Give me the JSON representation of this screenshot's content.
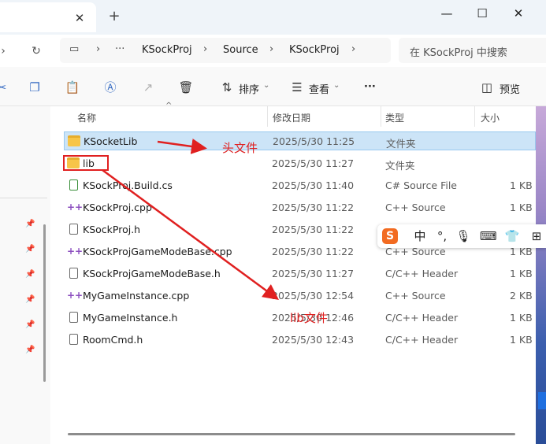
{
  "window": {
    "close_tab_glyph": "✕",
    "new_tab_glyph": "+",
    "minimize_glyph": "—",
    "maximize_glyph": "☐",
    "close_glyph": "✕"
  },
  "navbar": {
    "breadcrumbs": [
      "KSockProj",
      "Source",
      "KSockProj"
    ],
    "more_glyph": "···",
    "search_placeholder": "在 KSockProj 中搜索"
  },
  "commandbar": {
    "sort_label": "排序",
    "view_label": "查看",
    "more_glyph": "···",
    "preview_label": "预览"
  },
  "columns": {
    "name": "名称",
    "modified": "修改日期",
    "type": "类型",
    "size": "大小"
  },
  "files": [
    {
      "name": "KSocketLib",
      "date": "2025/5/30 11:25",
      "type": "文件夹",
      "size": "",
      "icon": "folder-icon",
      "selected": true
    },
    {
      "name": "lib",
      "date": "2025/5/30 11:27",
      "type": "文件夹",
      "size": "",
      "icon": "folder-icon",
      "selected": false
    },
    {
      "name": "KSockProj.Build.cs",
      "date": "2025/5/30 11:40",
      "type": "C# Source File",
      "size": "1 KB",
      "icon": "csharp-file-icon",
      "selected": false
    },
    {
      "name": "KSockProj.cpp",
      "date": "2025/5/30 11:22",
      "type": "C++ Source",
      "size": "1 KB",
      "icon": "cpp-file-icon",
      "selected": false
    },
    {
      "name": "KSockProj.h",
      "date": "2025/5/30 11:22",
      "type": "",
      "size": "",
      "icon": "header-file-icon",
      "selected": false
    },
    {
      "name": "KSockProjGameModeBase.cpp",
      "date": "2025/5/30 11:22",
      "type": "C++ Source",
      "size": "1 KB",
      "icon": "cpp-file-icon",
      "selected": false
    },
    {
      "name": "KSockProjGameModeBase.h",
      "date": "2025/5/30 11:27",
      "type": "C/C++ Header",
      "size": "1 KB",
      "icon": "header-file-icon",
      "selected": false
    },
    {
      "name": "MyGameInstance.cpp",
      "date": "2025/5/30 12:54",
      "type": "C++ Source",
      "size": "2 KB",
      "icon": "cpp-file-icon",
      "selected": false
    },
    {
      "name": "MyGameInstance.h",
      "date": "2025/5/30 12:46",
      "type": "C/C++ Header",
      "size": "1 KB",
      "icon": "header-file-icon",
      "selected": false
    },
    {
      "name": "RoomCmd.h",
      "date": "2025/5/30 12:43",
      "type": "C/C++ Header",
      "size": "1 KB",
      "icon": "header-file-icon",
      "selected": false
    }
  ],
  "ime": {
    "logo": "S",
    "mode": "中"
  },
  "annotations": {
    "header_label": "头文件",
    "lib_label": "lib文件",
    "color": "#e02020"
  }
}
